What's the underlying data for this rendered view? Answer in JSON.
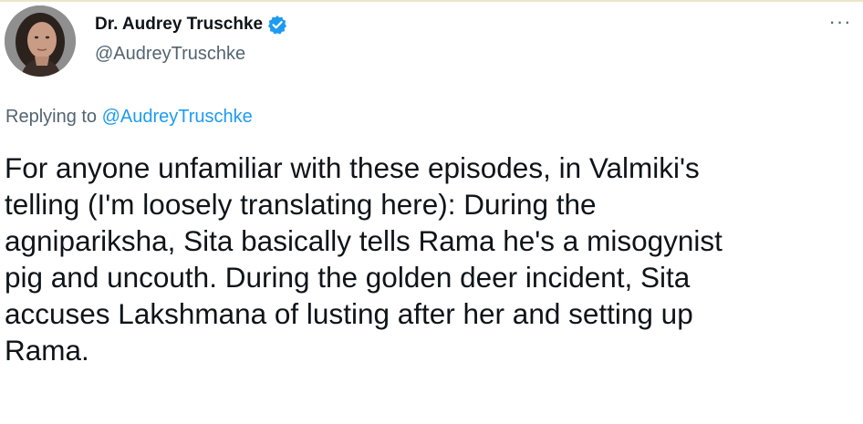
{
  "author": {
    "display_name": "Dr. Audrey Truschke",
    "handle": "@AudreyTruschke",
    "verified_icon": "verified-badge-icon",
    "avatar_icon": "avatar-photo"
  },
  "more_icon": "more-options-icon",
  "more_glyph": "···",
  "reply": {
    "prefix": "Replying to",
    "mention": "@AudreyTruschke"
  },
  "tweet": {
    "lines": [
      "For anyone unfamiliar with these episodes, in Valmiki's",
      "telling (I'm loosely translating here): During the",
      "agnipariksha, Sita basically tells Rama he's a misogynist",
      "pig and uncouth. During the golden deer incident, Sita",
      "accuses Lakshmana of lusting after her and setting up",
      "Rama."
    ]
  },
  "colors": {
    "text_primary": "#0f1419",
    "text_secondary": "#536471",
    "accent": "#1d9bf0",
    "verified": "#1d9bf0"
  }
}
